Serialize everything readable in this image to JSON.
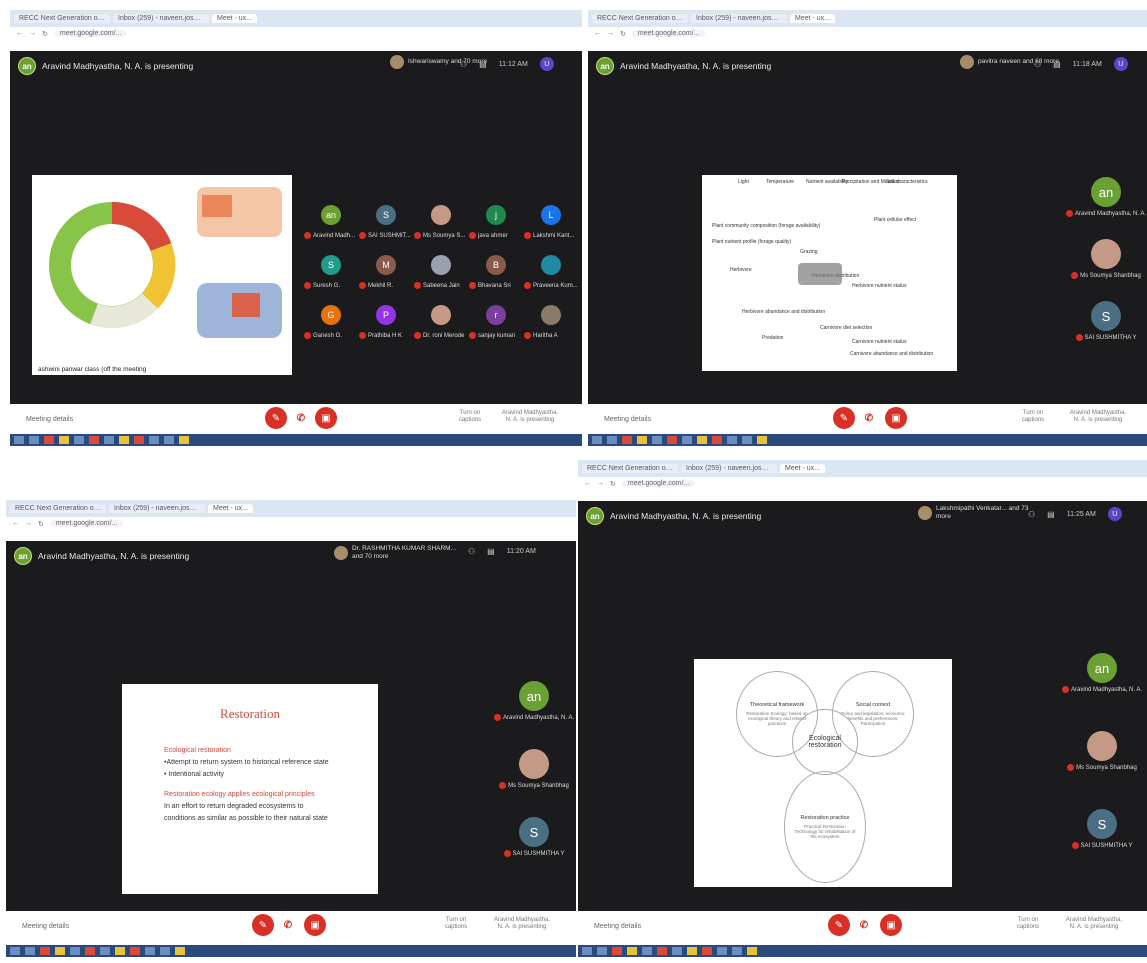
{
  "browser": {
    "tabs": [
      "RECC Next Generation of Supply",
      "Inbox (259) - naveen.joshua",
      "Meet - ux..."
    ],
    "url": "meet.google.com/..."
  },
  "meeting": {
    "presenter_text": "Aravind Madhyastha, N. A. is presenting",
    "meeting_details": "Meeting details",
    "turn_on_captions": "Turn on captions",
    "presenting_label": "Aravind Madhyastha, N. A. is presenting",
    "end_call_glyph": "✆",
    "mic_glyph": "✎",
    "cam_glyph": "▣",
    "more_glyph": "⋯"
  },
  "screens": [
    {
      "others": "Ishwariswamy and 70 more",
      "time": "11:12 AM",
      "chip": "ashwini panwar class (off the meeting",
      "tiles": [
        {
          "name": "Aravind Madh...",
          "initial": "an",
          "color": "#6aa132"
        },
        {
          "name": "SAI SUSHMIT...",
          "initial": "S",
          "color": "#4a6f82"
        },
        {
          "name": "Ms Soumya S...",
          "initial": "",
          "color": "#c49a86"
        },
        {
          "name": "java ahmer",
          "initial": "j",
          "color": "#1f8a4c"
        },
        {
          "name": "Lakshmi Kant...",
          "initial": "L",
          "color": "#1a73e8"
        },
        {
          "name": "Suresh G.",
          "initial": "S",
          "color": "#1f9c8a"
        },
        {
          "name": "Mekhil R.",
          "initial": "M",
          "color": "#8a5a4a"
        },
        {
          "name": "Sabeena Jain",
          "initial": "",
          "color": "#9aa0b0"
        },
        {
          "name": "Bhavana Sri",
          "initial": "B",
          "color": "#8a5a4a"
        },
        {
          "name": "Praveena Kum...",
          "initial": "",
          "color": "#1f8aa0"
        },
        {
          "name": "Ganesh G.",
          "initial": "G",
          "color": "#e8710a"
        },
        {
          "name": "Prathiba H K",
          "initial": "P",
          "color": "#9334e6"
        },
        {
          "name": "Dr. roni Merode",
          "initial": "",
          "color": "#c49a86"
        },
        {
          "name": "sanjay kumari",
          "initial": "r",
          "color": "#7b3fa0"
        },
        {
          "name": "Haritha A",
          "initial": "",
          "color": "#8a7a6a"
        }
      ]
    },
    {
      "others": "pavitra naveen and 68 more",
      "time": "11:18 AM",
      "participants": [
        {
          "name": "Aravind Madhyastha, N. A.",
          "initial": "an",
          "color": "#6aa132"
        },
        {
          "name": "Ms Soumya Shanbhag",
          "initial": "",
          "color": "#c49a86"
        },
        {
          "name": "SAI SUSHMITHA Y",
          "initial": "S",
          "color": "#4a6f82"
        }
      ],
      "flow_labels": [
        "Light",
        "Temperature",
        "Nutrient availability",
        "Precipitation and Moisture",
        "Soil characteristics",
        "Plant community composition (forage availability)",
        "Plant nutrient profile (forage quality)",
        "Plant cellular effect",
        "Grazing",
        "Herbivore",
        "Herbivore distribution",
        "Herbivore nutrient status",
        "Herbivore abundance and distribution",
        "Predation",
        "Carnivore diet selection",
        "Carnivore nutrient status",
        "Carnivore abundance and distribution"
      ]
    },
    {
      "others": "Dr. RASHMITHA KUMAR SHARM... and 70 more",
      "time": "11:20 AM",
      "slide": {
        "title": "Restoration",
        "heading1": "Ecological restoration",
        "line1": "•Attempt to return system to historical reference state",
        "line2": "• Intentional activity",
        "heading2": "Restoration ecology applies ecological principles",
        "line3": "In an effort to return degraded ecosystems to",
        "line4": "conditions as similar as possible to their natural state"
      },
      "participants": [
        {
          "name": "Aravind Madhyastha, N. A.",
          "initial": "an",
          "color": "#6aa132"
        },
        {
          "name": "Ms Soumya Shanbhag",
          "initial": "",
          "color": "#c49a86"
        },
        {
          "name": "SAI SUSHMITHA Y",
          "initial": "S",
          "color": "#4a6f82"
        }
      ]
    },
    {
      "others": "Lakshmipathi Venkatar... and 73 more",
      "time": "11:25 AM",
      "slide": {
        "center": "Ecological restoration",
        "top_left": "Theoretical framework",
        "top_left_body": "Restoration Ecology: based on ecological theory and related practices",
        "top_right": "Social context",
        "top_right_body": "Policy and legislation; economic benefits and preferences; Participation",
        "bottom": "Restoration practice",
        "bottom_body": "Practical Restoration Technology for rehabilitation of the ecosystem"
      },
      "participants": [
        {
          "name": "Aravind Madhyastha, N. A.",
          "initial": "an",
          "color": "#6aa132"
        },
        {
          "name": "Ms Soumya Shanbhag",
          "initial": "",
          "color": "#c49a86"
        },
        {
          "name": "SAI SUSHMITHA Y",
          "initial": "S",
          "color": "#4a6f82"
        }
      ]
    }
  ],
  "colors": {
    "meet_bg": "#1b1b1d",
    "end_red": "#d93025",
    "accent_green": "#6aa132",
    "slide_red": "#d24b3c"
  }
}
